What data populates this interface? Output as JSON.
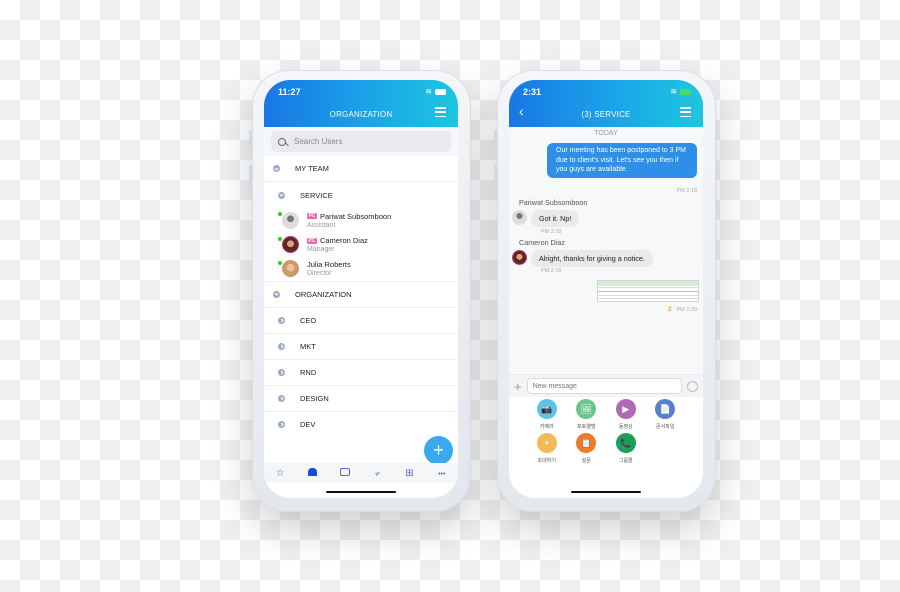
{
  "left_phone": {
    "status": {
      "time": "11:27"
    },
    "header": {
      "title": "ORGANIZATION"
    },
    "search": {
      "placeholder": "Search Users"
    },
    "tree": {
      "my_team": "MY TEAM",
      "service": "SERVICE",
      "members": [
        {
          "name": "Pariwat Subsomboon",
          "role": "Assistant",
          "badge": "PC",
          "online": true
        },
        {
          "name": "Cameron Diaz",
          "role": "Manager",
          "badge": "PC",
          "online": true
        },
        {
          "name": "Julia Roberts",
          "role": "Director",
          "badge": "",
          "online": true
        }
      ],
      "organization": "ORGANIZATION",
      "departments": [
        "CEO",
        "MKT",
        "RND",
        "DESIGN",
        "DEV"
      ]
    },
    "fab": {
      "label": "+"
    },
    "tabbar": [
      {
        "name": "favorites",
        "icon": "☆"
      },
      {
        "name": "organization",
        "icon": "👤"
      },
      {
        "name": "chat",
        "icon": "💬"
      },
      {
        "name": "send",
        "icon": "➤"
      },
      {
        "name": "apps",
        "icon": "⊞"
      },
      {
        "name": "more",
        "icon": "•••"
      }
    ]
  },
  "right_phone": {
    "status": {
      "time": "2:31"
    },
    "header": {
      "title": "(3) SERVICE"
    },
    "chat": {
      "day": "TODAY",
      "messages": [
        {
          "from": "me",
          "text": "Our meeting has been postponed to 3 PM due to client's visit. Let's see you then if you guys are available.",
          "time": "PM 2:18"
        },
        {
          "from": "Pariwat Subsomboon",
          "text": "Got it. Np!",
          "time": "PM 2:18"
        },
        {
          "from": "Cameron Diaz",
          "text": "Alright, thanks for giving a notice.",
          "time": "PM 2:18"
        },
        {
          "from": "me",
          "type": "image",
          "unread": "2",
          "time": "PM 2:30"
        }
      ]
    },
    "input": {
      "placeholder": "New message",
      "plus": "+"
    },
    "attachments": [
      {
        "label": "카메라",
        "icon": "📷",
        "color": "#5bc3e8"
      },
      {
        "label": "포토앨범",
        "icon": "🖼",
        "color": "#6cc48e"
      },
      {
        "label": "동영상",
        "icon": "▶",
        "color": "#b368b3"
      },
      {
        "label": "문서파일",
        "icon": "📄",
        "color": "#5b7fcf"
      },
      {
        "label": "초대하기",
        "icon": "+",
        "color": "#f4b85a"
      },
      {
        "label": "설문",
        "icon": "📋",
        "color": "#f07a2a"
      },
      {
        "label": "그룹콜",
        "icon": "📞",
        "color": "#1aa05a"
      }
    ]
  }
}
